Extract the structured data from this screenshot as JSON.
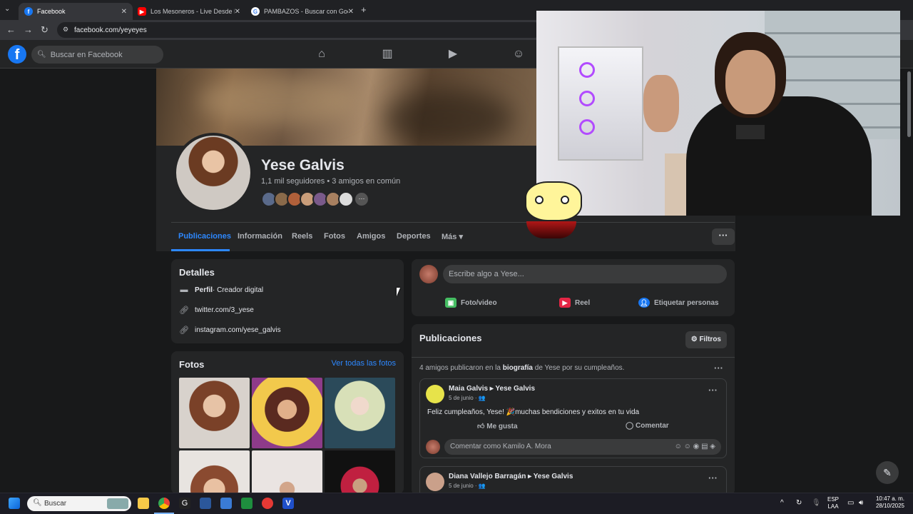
{
  "browser": {
    "tabs": [
      {
        "title": "Facebook",
        "active": true
      },
      {
        "title": "Los Mesoneros - Live Desde Pa",
        "active": false
      },
      {
        "title": "PAMBAZOS - Buscar con Goog",
        "active": false
      }
    ],
    "new_tab": "+",
    "url": "facebook.com/yeyeyes"
  },
  "fb": {
    "logo": "f",
    "search_placeholder": "Buscar en Facebook"
  },
  "profile": {
    "name": "Yese Galvis",
    "stats": "1,1 mil seguidores • 3 amigos en común",
    "tabs": [
      "Publicaciones",
      "Información",
      "Reels",
      "Fotos",
      "Amigos",
      "Deportes",
      "Más ▾"
    ],
    "more": "···"
  },
  "details": {
    "title": "Detalles",
    "rows": [
      {
        "bold": "Perfil",
        "text": " · Creador digital",
        "icon": "briefcase-icon"
      },
      {
        "text": "twitter.com/3_yese",
        "icon": "link-icon"
      },
      {
        "text": "instagram.com/yese_galvis",
        "icon": "link-icon"
      }
    ]
  },
  "photos": {
    "title": "Fotos",
    "see_all": "Ver todas las fotos"
  },
  "composer": {
    "placeholder": "Escribe algo a Yese...",
    "actions": [
      "Foto/video",
      "Reel",
      "Etiquetar personas"
    ]
  },
  "feed": {
    "title": "Publicaciones",
    "filters": "Filtros",
    "summary_pre": "4 amigos publicaron en la ",
    "summary_bold": "biografía",
    "summary_post": " de Yese por su cumpleaños.",
    "posts": [
      {
        "author": "Maia Galvis ▸ Yese Galvis",
        "date": "5 de junio · 👥",
        "text": "Feliz cumpleaños, Yese! 🎉muchas bendiciones y exitos en tu vida",
        "like": "Me gusta",
        "comment": "Comentar",
        "comment_placeholder": "Comentar como Kamilo A. Mora"
      },
      {
        "author": "Diana Vallejo Barragán ▸ Yese Galvis",
        "date": "5 de junio · 👥"
      }
    ]
  },
  "taskbar": {
    "search": "Buscar",
    "lang1": "ESP",
    "lang2": "LAA",
    "time": "10:47 a. m.",
    "date": "28/10/2025"
  },
  "colors": {
    "accent": "#2d88ff",
    "background": "#18191a",
    "surface": "#242526"
  }
}
